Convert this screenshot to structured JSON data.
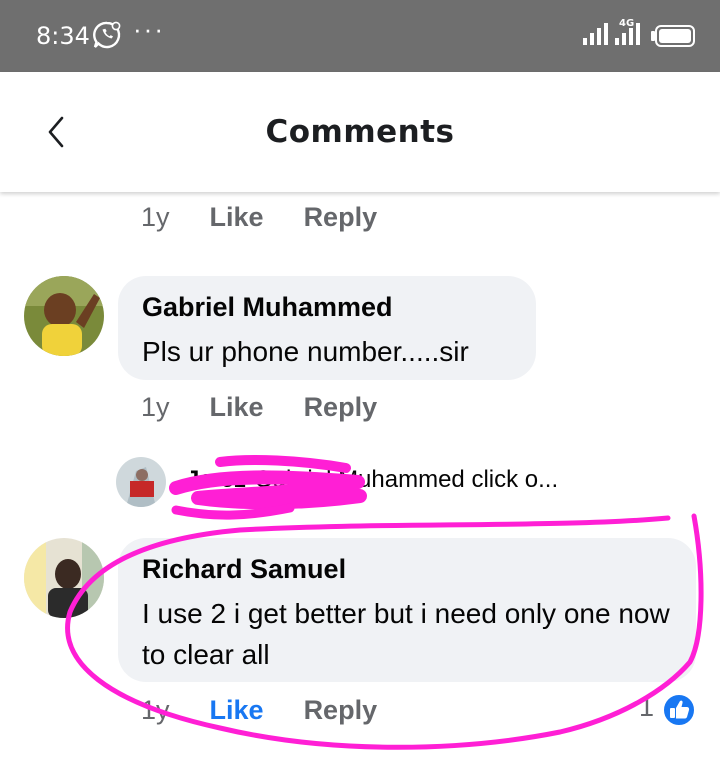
{
  "status_bar": {
    "time": "8:34",
    "app_icon": "whatsapp-icon",
    "more_indicator": "···",
    "network_label": "4G",
    "icons": [
      "signal-icon",
      "signal-icon",
      "battery-icon"
    ],
    "background_color": "#6f6f6f"
  },
  "header": {
    "title": "Comments",
    "back_icon": "chevron-left-icon"
  },
  "comments": [
    {
      "time": "1y",
      "like_label": "Like",
      "reply_label": "Reply"
    },
    {
      "author": "Gabriel Muhammed",
      "text": "Pls ur phone number.....sir",
      "time": "1y",
      "like_label": "Like",
      "reply_label": "Reply",
      "reply_preview": {
        "author": "Jo      ez",
        "text": "Gabriel Muhammed click o..."
      }
    },
    {
      "author": "Richard Samuel",
      "text": "I use 2 i get better but i need only one now to clear all",
      "time": "1y",
      "like_label": "Like",
      "like_active": true,
      "reply_label": "Reply",
      "reaction_count": "1",
      "reaction_icon": "thumbs-up-icon"
    }
  ],
  "colors": {
    "accent": "#1877f2",
    "bubble": "#f0f2f5",
    "meta_text": "#65676b",
    "annotation": "#ff1fd5"
  }
}
